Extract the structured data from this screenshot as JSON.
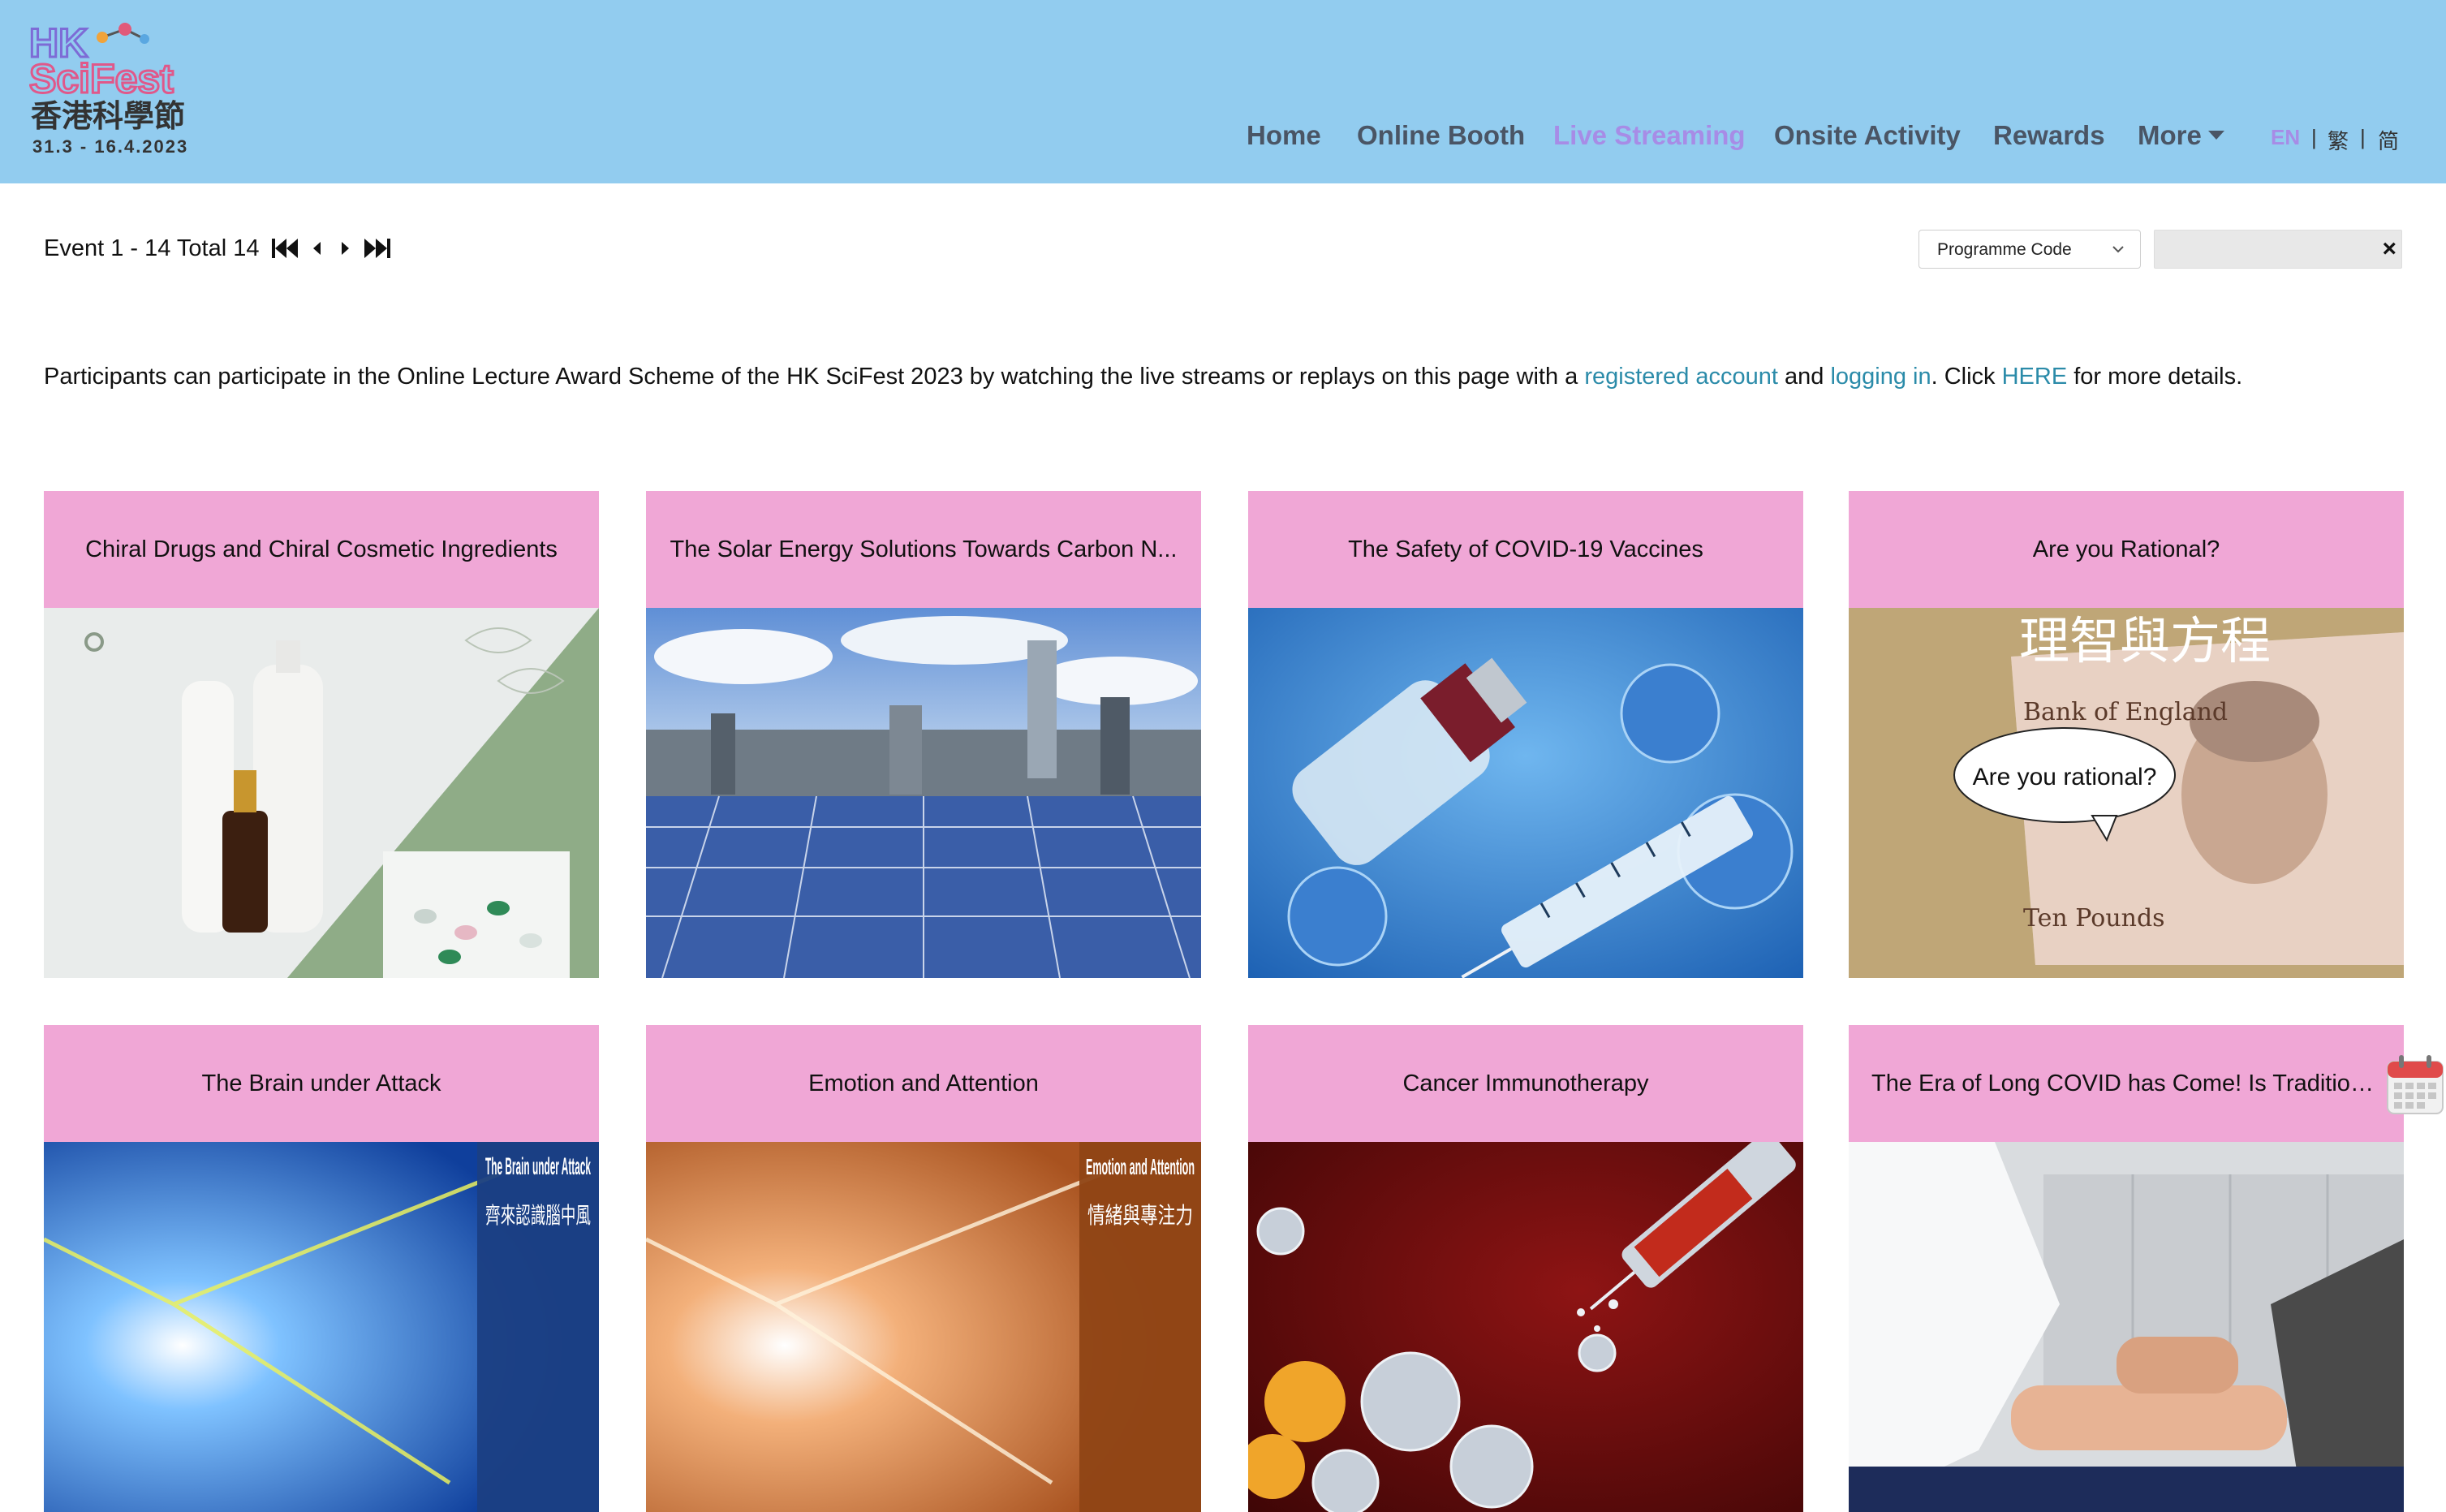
{
  "logo": {
    "name_en_top": "HK",
    "name_en_bottom": "SciFest",
    "name_zh": "香港科學節",
    "dates": "31.3 - 16.4.2023"
  },
  "nav": {
    "items": [
      "Home",
      "Online Booth",
      "Live Streaming",
      "Onsite Activity",
      "Rewards",
      "More"
    ],
    "active": "Live Streaming",
    "languages": [
      "EN",
      "繁",
      "简"
    ],
    "active_language": "EN",
    "separator": "|"
  },
  "toolbar": {
    "pager_text": "Event 1 - 14 Total 14",
    "filter_select": "Programme Code",
    "search_value": "",
    "clear_symbol": "×"
  },
  "notice": {
    "part1": "Participants can participate in the Online Lecture Award Scheme of the HK SciFest 2023 by watching the live streams or replays on this page with a ",
    "link1": "registered account",
    "part2": " and ",
    "link2": "logging in",
    "part3": ". Click ",
    "link3": "HERE",
    "part4": " for more details."
  },
  "colors": {
    "header_bg": "#92ccef",
    "nav_text": "#4a5565",
    "nav_active": "#a78ce6",
    "card_caption_bg": "#f0a7d6",
    "link": "#2b8ba9"
  },
  "cards": [
    {
      "title": "Chiral Drugs and Chiral Cosmetic Ingredients"
    },
    {
      "title": "The Solar Energy Solutions Towards Carbon N..."
    },
    {
      "title": "The Safety of COVID-19 Vaccines"
    },
    {
      "title": "Are you Rational?",
      "image_text_zh": "理智與方程",
      "image_bubble": "Are you rational?",
      "image_note_top": "Bank of England",
      "image_note_bottom": "Ten Pounds"
    },
    {
      "title": "The Brain under Attack",
      "image_text_en": "The Brain under Attack",
      "image_text_zh": "齊來認識腦中風"
    },
    {
      "title": "Emotion and Attention",
      "image_text_en": "Emotion and Attention",
      "image_text_zh": "情緒與專注力"
    },
    {
      "title": "Cancer Immunotherapy"
    },
    {
      "title": "The Era of Long COVID has Come! Is Tradition..."
    }
  ],
  "icons": {
    "pager_first": "skip-back-icon",
    "pager_prev": "caret-left-icon",
    "pager_next": "caret-right-icon",
    "pager_last": "skip-forward-icon",
    "calendar": "calendar-icon"
  }
}
